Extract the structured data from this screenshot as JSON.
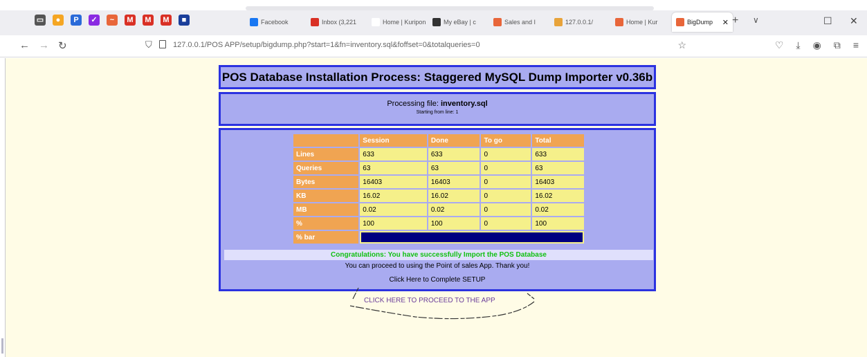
{
  "browser": {
    "pinned": [
      {
        "name": "pin-1",
        "color": "#555555",
        "glyph": "▭"
      },
      {
        "name": "pin-2",
        "color": "#f5a623",
        "glyph": "●"
      },
      {
        "name": "pin-3",
        "color": "#2a6ad8",
        "glyph": "P"
      },
      {
        "name": "pin-4",
        "color": "#8a2be2",
        "glyph": "✓"
      },
      {
        "name": "pin-5",
        "color": "#e8663a",
        "glyph": "~"
      },
      {
        "name": "pin-6",
        "color": "#d93025",
        "glyph": "M"
      },
      {
        "name": "pin-7",
        "color": "#d93025",
        "glyph": "M"
      },
      {
        "name": "pin-8",
        "color": "#d93025",
        "glyph": "M"
      },
      {
        "name": "pin-9",
        "color": "#1a3e9a",
        "glyph": "■"
      }
    ],
    "tabs": [
      {
        "label": "Facebook",
        "color": "#1877f2"
      },
      {
        "label": "Inbox (3,221",
        "color": "#d93025"
      },
      {
        "label": "Home | Kuripon",
        "color": "#ffffff"
      },
      {
        "label": "My eBay | c",
        "color": "#333333"
      },
      {
        "label": "Sales and I",
        "color": "#e8663a"
      },
      {
        "label": "127.0.0.1/",
        "color": "#e8a33a"
      },
      {
        "label": "Home | Kur",
        "color": "#e8663a"
      },
      {
        "label": "BigDump",
        "color": "#e8663a",
        "active": true
      }
    ],
    "url": "127.0.0.1/POS APP/setup/bigdump.php?start=1&fn=inventory.sql&foffset=0&totalqueries=0"
  },
  "page": {
    "title": "POS Database Installation Process: Staggered MySQL Dump Importer v0.36b",
    "processing_label": "Processing file:",
    "filename": "inventory.sql",
    "starting": "Starting from line: 1",
    "table": {
      "headers": [
        "",
        "Session",
        "Done",
        "To go",
        "Total"
      ],
      "rows": [
        {
          "label": "Lines",
          "values": [
            "633",
            "633",
            "0",
            "633"
          ]
        },
        {
          "label": "Queries",
          "values": [
            "63",
            "63",
            "0",
            "63"
          ]
        },
        {
          "label": "Bytes",
          "values": [
            "16403",
            "16403",
            "0",
            "16403"
          ]
        },
        {
          "label": "KB",
          "values": [
            "16.02",
            "16.02",
            "0",
            "16.02"
          ]
        },
        {
          "label": "MB",
          "values": [
            "0.02",
            "0.02",
            "0",
            "0.02"
          ]
        },
        {
          "label": "%",
          "values": [
            "100",
            "100",
            "0",
            "100"
          ]
        }
      ],
      "bar_label": "% bar",
      "bar_percent": 100
    },
    "congrats": "Congratulations: You have successfully Import the POS Database",
    "proceed": "You can proceed to using the Point of sales App. Thank you!",
    "complete": "Click Here to Complete SETUP",
    "app_link": "CLICK HERE TO PROCEED TO THE APP"
  }
}
